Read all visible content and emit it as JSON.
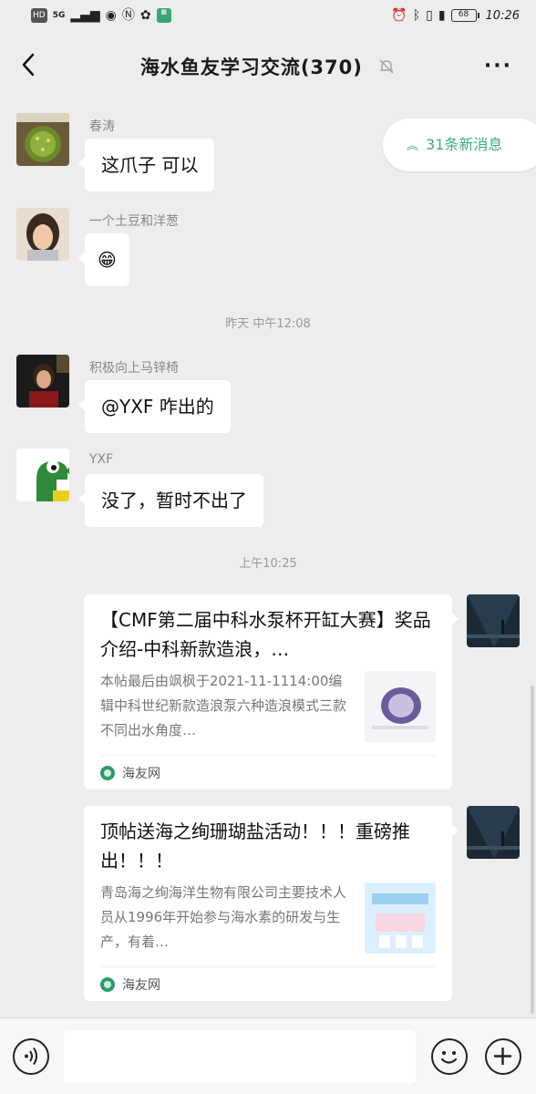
{
  "status_bar": {
    "left_chips": [
      "HD",
      "5G"
    ],
    "time": "10:26",
    "battery": "68"
  },
  "header": {
    "title": "海水鱼友学习交流(370)",
    "back_icon": "chevron-left-icon",
    "mute_icon": "bell-off-icon",
    "more_label": "···"
  },
  "new_messages": {
    "label": "31条新消息",
    "icon": "double-chevron-up-icon"
  },
  "messages": [
    {
      "sender": "春涛",
      "text": "这爪子 可以"
    },
    {
      "sender": "一个土豆和洋葱",
      "text": "😁"
    },
    {
      "sender": "积极向上马锌椅",
      "text": "@YXF 咋出的"
    },
    {
      "sender": "YXF",
      "text": "没了，暂时不出了"
    }
  ],
  "timestamps": [
    "昨天 中午12:08",
    "上午10:25"
  ],
  "cards": [
    {
      "title": "【CMF第二届中科水泵杯开缸大赛】奖品介绍-中科新款造浪，…",
      "desc": "本帖最后由飒枫于2021-11-1114:00编辑中科世纪新款造浪泵六种造浪模式三款不同出水角度…",
      "source": "海友网"
    },
    {
      "title": "顶帖送海之绚珊瑚盐活动！！！重磅推出！！！",
      "desc": "青岛海之绚海洋生物有限公司主要技术人员从1996年开始参与海水素的研发与生产，有着…",
      "source": "海友网"
    }
  ],
  "colors": {
    "accent": "#3bae78",
    "background": "#ededed"
  }
}
